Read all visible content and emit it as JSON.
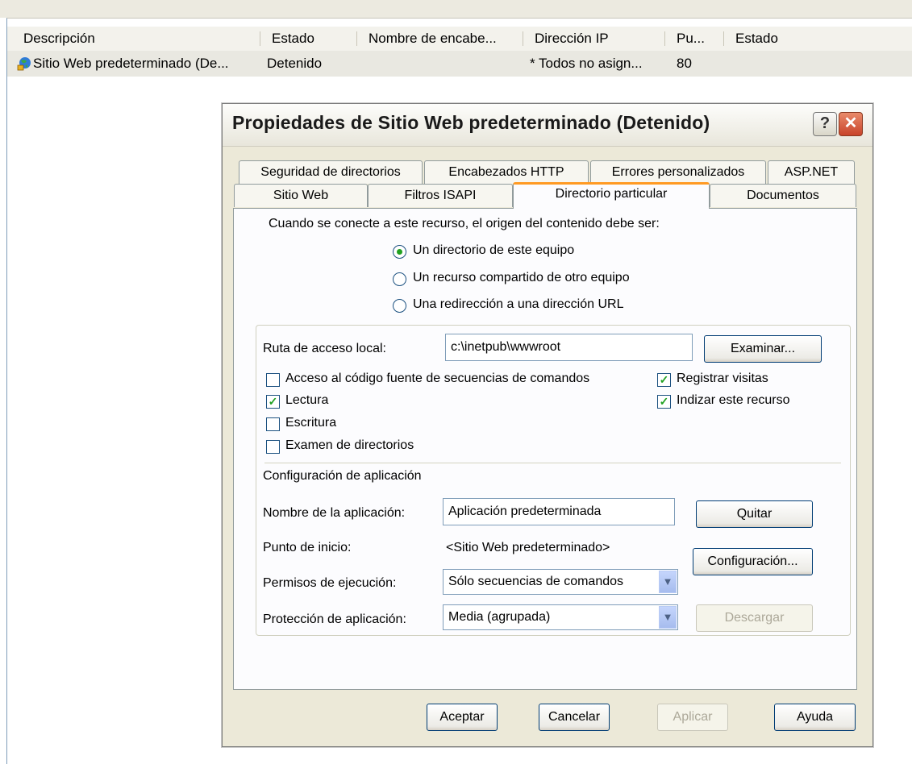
{
  "list": {
    "columns": [
      "Descripción",
      "Estado",
      "Nombre de encabe...",
      "Dirección IP",
      "Pu...",
      "Estado"
    ],
    "row": {
      "description": "Sitio Web predeterminado (De...",
      "status": "Detenido",
      "ip": "* Todos no asign...",
      "port": "80"
    }
  },
  "dialog": {
    "title": "Propiedades de Sitio Web predeterminado (Detenido)",
    "help_glyph": "?",
    "close_glyph": "✕",
    "tabs_row1": [
      "Seguridad de directorios",
      "Encabezados HTTP",
      "Errores personalizados",
      "ASP.NET"
    ],
    "tabs_row2": [
      "Sitio Web",
      "Filtros ISAPI",
      "Directorio particular",
      "Documentos"
    ],
    "active_tab": "Directorio particular",
    "intro": "Cuando se conecte a este recurso, el origen del contenido debe ser:",
    "radios": [
      {
        "label": "Un directorio de este equipo",
        "checked": true
      },
      {
        "label": "Un recurso compartido de otro equipo",
        "checked": false
      },
      {
        "label": "Una redirección a una dirección URL",
        "checked": false
      }
    ],
    "local_path": {
      "label": "Ruta de acceso local:",
      "value": "c:\\inetpub\\wwwroot",
      "browse": "Examinar..."
    },
    "checkboxes_left": [
      {
        "label": "Acceso al código fuente de secuencias de comandos",
        "checked": false
      },
      {
        "label": "Lectura",
        "checked": true
      },
      {
        "label": "Escritura",
        "checked": false
      },
      {
        "label": "Examen de directorios",
        "checked": false
      }
    ],
    "checkboxes_right": [
      {
        "label": "Registrar visitas",
        "checked": true
      },
      {
        "label": "Indizar este recurso",
        "checked": true
      }
    ],
    "app_config": {
      "heading": "Configuración de aplicación",
      "name_label": "Nombre de la aplicación:",
      "name_value": "Aplicación predeterminada",
      "remove": "Quitar",
      "start_label": "Punto de inicio:",
      "start_value": "<Sitio Web predeterminado>",
      "config": "Configuración...",
      "exec_label": "Permisos de ejecución:",
      "exec_value": "Sólo secuencias de comandos",
      "protect_label": "Protección de aplicación:",
      "protect_value": "Media (agrupada)",
      "unload": "Descargar"
    },
    "buttons": {
      "ok": "Aceptar",
      "cancel": "Cancelar",
      "apply": "Aplicar",
      "help": "Ayuda"
    }
  },
  "icons": {
    "site": "globe-icon",
    "dropdown": "chevron-down-icon"
  }
}
